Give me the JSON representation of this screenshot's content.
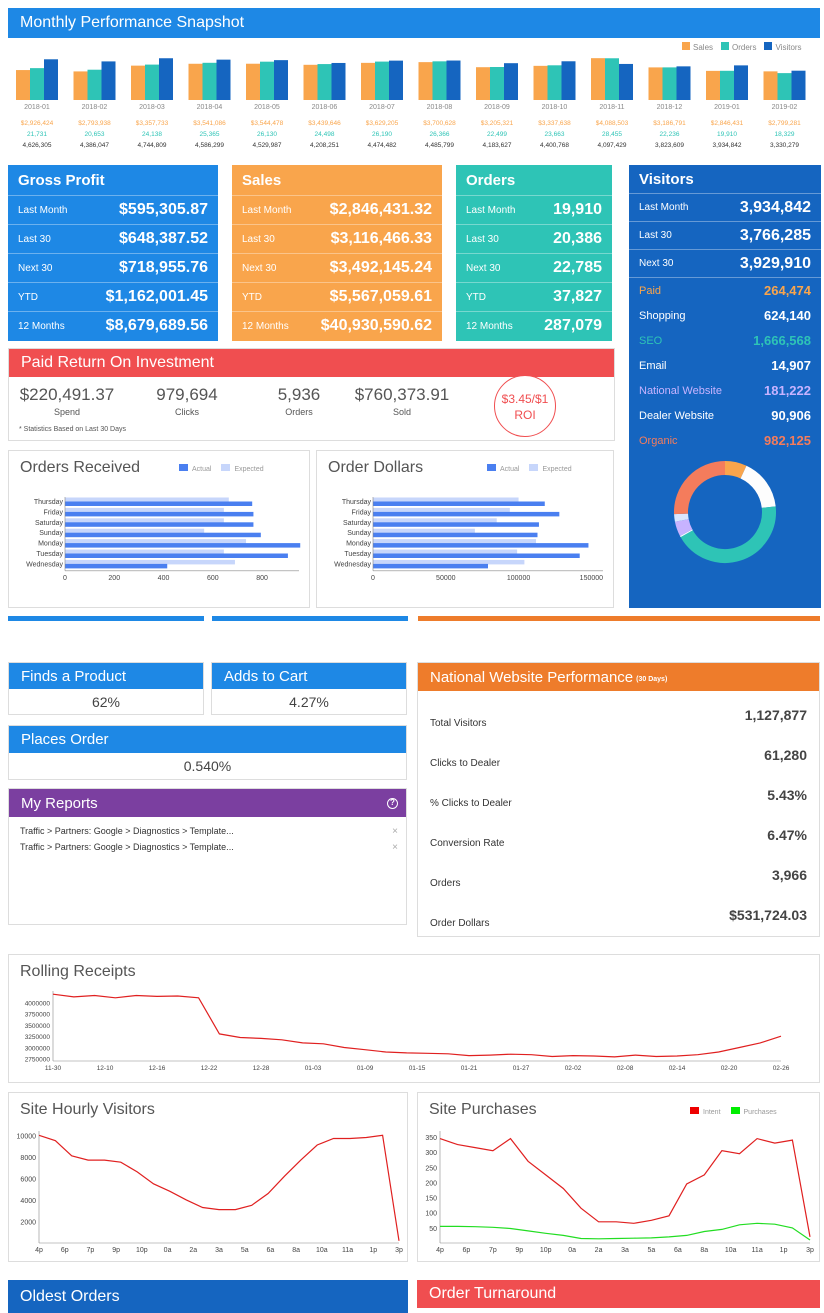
{
  "snapshot": {
    "title": "Monthly Performance Snapshot",
    "legend": [
      "Sales",
      "Orders",
      "Visitors"
    ],
    "colors": {
      "sales": "#f9a54c",
      "orders": "#2ec4b6",
      "visitors": "#1565c0"
    },
    "months": [
      {
        "label": "2018-01",
        "sales": "$2,926,424",
        "orders": "21,731",
        "visitors": "4,626,305"
      },
      {
        "label": "2018-02",
        "sales": "$2,793,938",
        "orders": "20,653",
        "visitors": "4,386,047"
      },
      {
        "label": "2018-03",
        "sales": "$3,357,733",
        "orders": "24,138",
        "visitors": "4,744,809"
      },
      {
        "label": "2018-04",
        "sales": "$3,541,086",
        "orders": "25,365",
        "visitors": "4,586,299"
      },
      {
        "label": "2018-05",
        "sales": "$3,544,478",
        "orders": "26,130",
        "visitors": "4,529,987"
      },
      {
        "label": "2018-06",
        "sales": "$3,439,646",
        "orders": "24,498",
        "visitors": "4,208,251"
      },
      {
        "label": "2018-07",
        "sales": "$3,629,205",
        "orders": "26,190",
        "visitors": "4,474,482"
      },
      {
        "label": "2018-08",
        "sales": "$3,700,628",
        "orders": "26,366",
        "visitors": "4,485,799"
      },
      {
        "label": "2018-09",
        "sales": "$3,205,321",
        "orders": "22,499",
        "visitors": "4,183,627"
      },
      {
        "label": "2018-10",
        "sales": "$3,337,638",
        "orders": "23,663",
        "visitors": "4,400,768"
      },
      {
        "label": "2018-11",
        "sales": "$4,088,503",
        "orders": "28,455",
        "visitors": "4,097,429"
      },
      {
        "label": "2018-12",
        "sales": "$3,186,791",
        "orders": "22,236",
        "visitors": "3,823,609"
      },
      {
        "label": "2019-01",
        "sales": "$2,846,431",
        "orders": "19,910",
        "visitors": "3,934,842"
      },
      {
        "label": "2019-02",
        "sales": "$2,799,281",
        "orders": "18,329",
        "visitors": "3,330,279"
      }
    ]
  },
  "gross_profit": {
    "title": "Gross Profit",
    "rows": [
      {
        "label": "Last Month",
        "value": "$595,305.87"
      },
      {
        "label": "Last 30",
        "value": "$648,387.52"
      },
      {
        "label": "Next 30",
        "value": "$718,955.76"
      },
      {
        "label": "YTD",
        "value": "$1,162,001.45"
      },
      {
        "label": "12 Months",
        "value": "$8,679,689.56"
      }
    ]
  },
  "sales": {
    "title": "Sales",
    "rows": [
      {
        "label": "Last Month",
        "value": "$2,846,431.32"
      },
      {
        "label": "Last 30",
        "value": "$3,116,466.33"
      },
      {
        "label": "Next 30",
        "value": "$3,492,145.24"
      },
      {
        "label": "YTD",
        "value": "$5,567,059.61"
      },
      {
        "label": "12 Months",
        "value": "$40,930,590.62"
      }
    ]
  },
  "orders": {
    "title": "Orders",
    "rows": [
      {
        "label": "Last Month",
        "value": "19,910"
      },
      {
        "label": "Last 30",
        "value": "20,386"
      },
      {
        "label": "Next 30",
        "value": "22,785"
      },
      {
        "label": "YTD",
        "value": "37,827"
      },
      {
        "label": "12 Months",
        "value": "287,079"
      }
    ]
  },
  "visitors": {
    "title": "Visitors",
    "rows": [
      {
        "label": "Last Month",
        "value": "3,934,842"
      },
      {
        "label": "Last 30",
        "value": "3,766,285"
      },
      {
        "label": "Next 30",
        "value": "3,929,910"
      }
    ],
    "sources": [
      {
        "label": "Paid",
        "value": "264,474",
        "color": "#f9a54c"
      },
      {
        "label": "Shopping",
        "value": "624,140",
        "color": "#ffffff"
      },
      {
        "label": "SEO",
        "value": "1,666,568",
        "color": "#2ec4b6"
      },
      {
        "label": "Email",
        "value": "14,907",
        "color": "#ffffff"
      },
      {
        "label": "National Website",
        "value": "181,222",
        "color": "#c7b3ff"
      },
      {
        "label": "Dealer Website",
        "value": "90,906",
        "color": "#ffffff"
      },
      {
        "label": "Organic",
        "value": "982,125",
        "color": "#f47c5c"
      }
    ]
  },
  "roi": {
    "title": "Paid Return On Investment",
    "stats": [
      {
        "value": "$220,491.37",
        "label": "Spend"
      },
      {
        "value": "979,694",
        "label": "Clicks"
      },
      {
        "value": "5,936",
        "label": "Orders"
      },
      {
        "value": "$760,373.91",
        "label": "Sold"
      }
    ],
    "badge_value": "$3.45/$1",
    "badge_label": "ROI",
    "note": "* Statistics Based on Last 30 Days"
  },
  "orders_received": {
    "title": "Orders Received",
    "legend": [
      "Actual",
      "Expected"
    ]
  },
  "order_dollars": {
    "title": "Order Dollars",
    "legend": [
      "Actual",
      "Expected"
    ]
  },
  "funnel": {
    "finds": {
      "label": "Finds a Product",
      "value": "62%"
    },
    "cart": {
      "label": "Adds to Cart",
      "value": "4.27%"
    },
    "order": {
      "label": "Places Order",
      "value": "0.540%"
    }
  },
  "reports": {
    "title": "My Reports",
    "items": [
      "Traffic > Partners: Google > Diagnostics > Template...",
      "Traffic > Partners: Google > Diagnostics > Template..."
    ]
  },
  "national": {
    "title": "National Website Performance",
    "subtitle": "(30 Days)",
    "rows": [
      {
        "label": "Total Visitors",
        "value": "1,127,877"
      },
      {
        "label": "Clicks to Dealer",
        "value": "61,280"
      },
      {
        "label": "% Clicks to Dealer",
        "value": "5.43%"
      },
      {
        "label": "Conversion Rate",
        "value": "6.47%"
      },
      {
        "label": "Orders",
        "value": "3,966"
      },
      {
        "label": "Order Dollars",
        "value": "$531,724.03"
      }
    ]
  },
  "rolling": {
    "title": "Rolling Receipts"
  },
  "hourly": {
    "title": "Site Hourly Visitors"
  },
  "purchases": {
    "title": "Site Purchases",
    "legend": [
      "Intent",
      "Purchases"
    ]
  },
  "footer": {
    "oldest": "Oldest Orders",
    "turnaround": "Order Turnaround"
  },
  "chart_data": [
    {
      "type": "bar",
      "title": "Monthly Performance Snapshot",
      "categories": [
        "2018-01",
        "2018-02",
        "2018-03",
        "2018-04",
        "2018-05",
        "2018-06",
        "2018-07",
        "2018-08",
        "2018-09",
        "2018-10",
        "2018-11",
        "2018-12",
        "2019-01",
        "2019-02"
      ],
      "series": [
        {
          "name": "Sales",
          "values": [
            2926424,
            2793938,
            3357733,
            3541086,
            3544478,
            3439646,
            3629205,
            3700628,
            3205321,
            3337638,
            4088503,
            3186791,
            2846431,
            2799281
          ]
        },
        {
          "name": "Orders",
          "values": [
            21731,
            20653,
            24138,
            25365,
            26130,
            24498,
            26190,
            26366,
            22499,
            23663,
            28455,
            22236,
            19910,
            18329
          ]
        },
        {
          "name": "Visitors",
          "values": [
            4626305,
            4386047,
            4744809,
            4586299,
            4529987,
            4208251,
            4474482,
            4485799,
            4183627,
            4400768,
            4097429,
            3823609,
            3934842,
            3330279
          ]
        }
      ]
    },
    {
      "type": "bar",
      "title": "Orders Received",
      "categories": [
        "Thursday",
        "Friday",
        "Saturday",
        "Sunday",
        "Monday",
        "Tuesday",
        "Wednesday"
      ],
      "xticks": [
        "0",
        "200",
        "400",
        "600",
        "800"
      ],
      "xlim": [
        0,
        950
      ],
      "series": [
        {
          "name": "Actual",
          "values": [
            760,
            765,
            765,
            795,
            955,
            905,
            415
          ]
        },
        {
          "name": "Expected",
          "values": [
            665,
            645,
            645,
            565,
            735,
            645,
            690
          ]
        }
      ]
    },
    {
      "type": "bar",
      "title": "Order Dollars",
      "categories": [
        "Thursday",
        "Friday",
        "Saturday",
        "Sunday",
        "Monday",
        "Tuesday",
        "Wednesday"
      ],
      "xticks": [
        "0",
        "50000",
        "100000",
        "150000"
      ],
      "xlim": [
        0,
        158000
      ],
      "series": [
        {
          "name": "Actual",
          "values": [
            118000,
            128000,
            114000,
            113000,
            148000,
            142000,
            79000
          ]
        },
        {
          "name": "Expected",
          "values": [
            100000,
            94000,
            85000,
            70000,
            112000,
            99000,
            104000
          ]
        }
      ]
    },
    {
      "type": "line",
      "title": "Rolling Receipts",
      "x": [
        "11-30",
        "12-10",
        "12-16",
        "12-22",
        "12-28",
        "01-03",
        "01-09",
        "01-15",
        "01-21",
        "01-27",
        "02-02",
        "02-08",
        "02-14",
        "02-20",
        "02-26"
      ],
      "yticks": [
        "4000000",
        "3750000",
        "3500000",
        "3250000",
        "3000000",
        "2750000"
      ],
      "ylim": [
        2700000,
        4250000
      ],
      "series": [
        {
          "name": "Receipts",
          "values": [
            4180000,
            4120000,
            4150000,
            4100000,
            4150000,
            4130000,
            4140000,
            4100000,
            3300000,
            3220000,
            3200000,
            3170000,
            3100000,
            3080000,
            3000000,
            2950000,
            2900000,
            2880000,
            2870000,
            2860000,
            2820000,
            2830000,
            2850000,
            2840000,
            2800000,
            2820000,
            2810000,
            2790000,
            2830000,
            2800000,
            2810000,
            2840000,
            2900000,
            3000000,
            3100000,
            3250000
          ]
        }
      ]
    },
    {
      "type": "line",
      "title": "Site Hourly Visitors",
      "x": [
        "4p",
        "6p",
        "7p",
        "9p",
        "10p",
        "0a",
        "2a",
        "3a",
        "5a",
        "6a",
        "8a",
        "10a",
        "11a",
        "1p",
        "3p"
      ],
      "yticks": [
        "10000",
        "8000",
        "6000",
        "4000",
        "2000"
      ],
      "ylim": [
        0,
        10400
      ],
      "series": [
        {
          "name": "Visitors",
          "values": [
            10000,
            9500,
            8100,
            7700,
            7700,
            7500,
            6600,
            5500,
            4800,
            4000,
            3300,
            3100,
            3100,
            3500,
            4600,
            6200,
            7700,
            9100,
            9700,
            9700,
            9800,
            10000,
            200
          ]
        }
      ]
    },
    {
      "type": "line",
      "title": "Site Purchases",
      "x": [
        "4p",
        "6p",
        "7p",
        "9p",
        "10p",
        "0a",
        "2a",
        "3a",
        "5a",
        "6a",
        "8a",
        "10a",
        "11a",
        "1p",
        "3p"
      ],
      "yticks": [
        "350",
        "300",
        "250",
        "200",
        "150",
        "100",
        "50"
      ],
      "ylim": [
        0,
        370
      ],
      "series": [
        {
          "name": "Intent",
          "values": [
            345,
            325,
            315,
            305,
            345,
            270,
            225,
            180,
            115,
            70,
            70,
            65,
            75,
            90,
            195,
            225,
            305,
            295,
            345,
            330,
            340,
            20
          ]
        },
        {
          "name": "Purchases",
          "values": [
            55,
            55,
            54,
            52,
            48,
            40,
            32,
            25,
            15,
            14,
            15,
            16,
            17,
            20,
            25,
            38,
            45,
            60,
            65,
            62,
            50,
            10
          ]
        }
      ]
    }
  ]
}
